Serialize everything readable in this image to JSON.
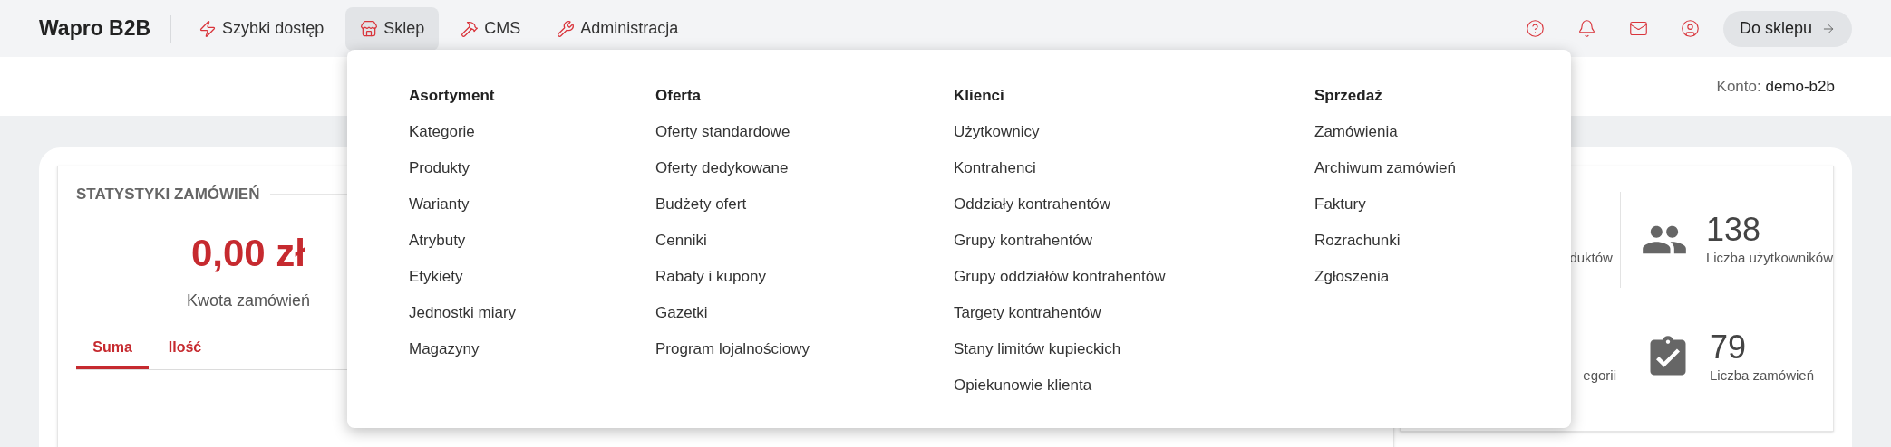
{
  "header": {
    "logo": "Wapro B2B",
    "nav": [
      {
        "label": "Szybki dostęp",
        "selected": false
      },
      {
        "label": "Sklep",
        "selected": true
      },
      {
        "label": "CMS",
        "selected": false
      },
      {
        "label": "Administracja",
        "selected": false
      }
    ],
    "shop_button": "Do sklepu"
  },
  "account": {
    "label": "Konto:",
    "value": "demo-b2b"
  },
  "menu": {
    "columns": [
      {
        "title": "Asortyment",
        "items": [
          "Kategorie",
          "Produkty",
          "Warianty",
          "Atrybuty",
          "Etykiety",
          "Jednostki miary",
          "Magazyny"
        ]
      },
      {
        "title": "Oferta",
        "items": [
          "Oferty standardowe",
          "Oferty dedykowane",
          "Budżety ofert",
          "Cenniki",
          "Rabaty i kupony",
          "Gazetki",
          "Program lojalnościowy"
        ]
      },
      {
        "title": "Klienci",
        "items": [
          "Użytkownicy",
          "Kontrahenci",
          "Oddziały kontrahentów",
          "Grupy kontrahentów",
          "Grupy oddziałów kontrahentów",
          "Targety kontrahentów",
          "Stany limitów kupieckich",
          "Opiekunowie klienta"
        ]
      },
      {
        "title": "Sprzedaż",
        "items": [
          "Zamówienia",
          "Archiwum zamówień",
          "Faktury",
          "Rozrachunki",
          "Zgłoszenia"
        ]
      }
    ]
  },
  "order_stats": {
    "title": "STATYSTYKI ZAMÓWIEŃ",
    "amount": "0,00 zł",
    "amount_label": "Kwota zamówień",
    "tabs": [
      {
        "label": "Suma",
        "selected": true
      },
      {
        "label": "Ilość",
        "selected": false
      }
    ]
  },
  "summary": {
    "rows": [
      {
        "left_label": "duktów",
        "value": "138",
        "label": "Liczba użytkowników"
      },
      {
        "left_label": "egorii",
        "value": "79",
        "label": "Liczba zamówień"
      }
    ]
  }
}
